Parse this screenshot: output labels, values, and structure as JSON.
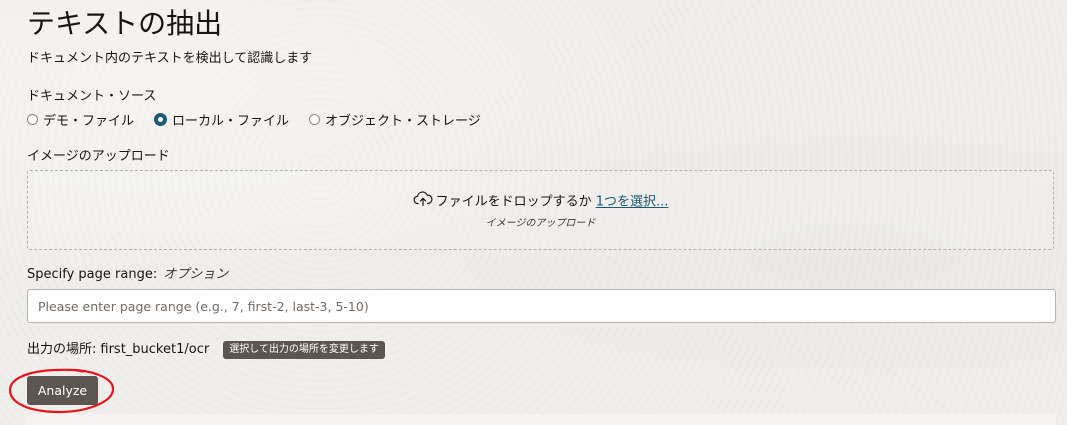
{
  "page": {
    "title": "テキストの抽出",
    "subtitle": "ドキュメント内のテキストを検出して認識します"
  },
  "document_source": {
    "label": "ドキュメント・ソース",
    "options": [
      {
        "label": "デモ・ファイル",
        "selected": false
      },
      {
        "label": "ローカル・ファイル",
        "selected": true
      },
      {
        "label": "オブジェクト・ストレージ",
        "selected": false
      }
    ]
  },
  "upload": {
    "label": "イメージのアップロード",
    "drop_text": "ファイルをドロップするか",
    "select_link": "1つを選択...",
    "sub_text": "イメージのアップロード",
    "icon": "cloud-upload-icon"
  },
  "page_range": {
    "label": "Specify page range:",
    "optional": "オプション",
    "placeholder": "Please enter page range (e.g., 7, first-2, last-3, 5-10)",
    "value": ""
  },
  "output": {
    "label": "出力の場所:",
    "path": "first_bucket1/ocr",
    "change_button": "選択して出力の場所を変更します"
  },
  "actions": {
    "analyze": "Analyze"
  },
  "colors": {
    "accent": "#1b5a73",
    "button": "#5d5650",
    "annotation": "#e8141c",
    "background": "#f1efec"
  }
}
